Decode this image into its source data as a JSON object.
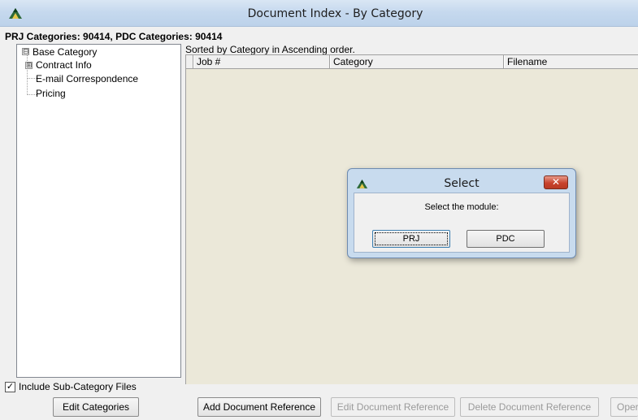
{
  "window": {
    "title": "Document Index - By Category",
    "icon": "app-logo-icon"
  },
  "header": {
    "categories_text": "PRJ Categories: 90414, PDC Categories: 90414"
  },
  "tree": {
    "root": {
      "label": "Base Category",
      "expander": "⊟"
    },
    "items": [
      {
        "label": "Contract Info",
        "expander": "⊞"
      },
      {
        "label": "E-mail Correspondence"
      },
      {
        "label": "Pricing"
      }
    ]
  },
  "grid": {
    "sort_text": "Sorted by Category in Ascending order.",
    "columns": [
      "Job #",
      "Category",
      "Filename"
    ],
    "rows": []
  },
  "options": {
    "include_subcategory_label": "Include Sub-Category Files",
    "include_subcategory_checked": "✓"
  },
  "buttons": {
    "edit_categories": "Edit Categories",
    "add_reference": "Add Document Reference",
    "edit_reference": "Edit Document Reference",
    "delete_reference": "Delete Document Reference",
    "open": "Oper"
  },
  "dialog": {
    "title": "Select",
    "close": "✕",
    "message": "Select the module:",
    "options": [
      "PRJ",
      "PDC"
    ]
  },
  "colors": {
    "grid_background": "#ebe8d9",
    "dialog_frame": "#c8dbee",
    "close_button": "#c8432d"
  }
}
